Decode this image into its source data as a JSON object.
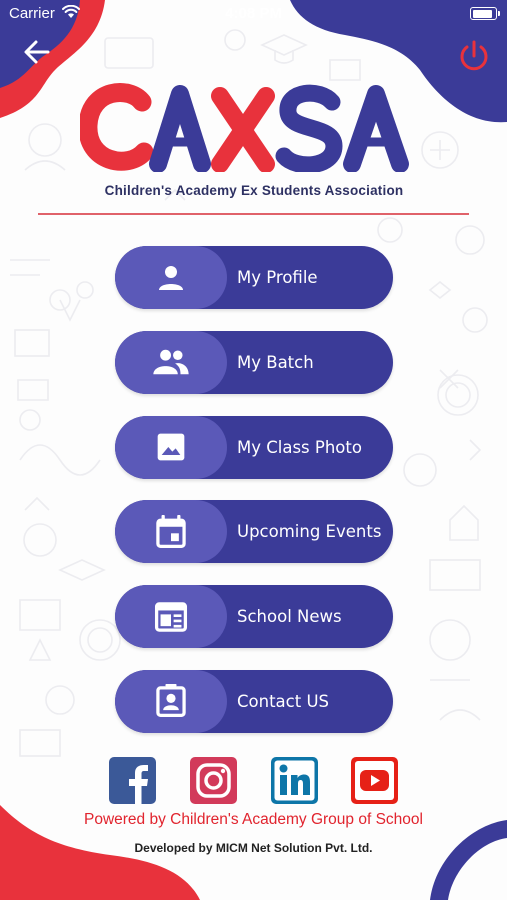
{
  "status_bar": {
    "carrier": "Carrier",
    "time": "4:08 PM"
  },
  "header": {
    "back_icon": "arrow-left-icon",
    "power_icon": "power-icon"
  },
  "brand": {
    "logo_text": "CAXSA",
    "subtitle": "Children's Academy Ex Students Association",
    "colors": {
      "red": "#e8323c",
      "navy": "#3b3b98"
    }
  },
  "menu": {
    "items": [
      {
        "label": "My Profile",
        "icon": "person-icon"
      },
      {
        "label": "My Batch",
        "icon": "group-icon"
      },
      {
        "label": "My Class Photo",
        "icon": "image-icon"
      },
      {
        "label": "Upcoming Events",
        "icon": "calendar-icon"
      },
      {
        "label": "School News",
        "icon": "news-icon"
      },
      {
        "label": "Contact US",
        "icon": "contact-card-icon"
      }
    ],
    "colors": {
      "button": "#3b3b98",
      "icon_panel": "#5b59b8"
    }
  },
  "social": [
    {
      "name": "facebook-icon",
      "color": "#3b5998"
    },
    {
      "name": "instagram-icon",
      "color": "#e1306c"
    },
    {
      "name": "linkedin-icon",
      "color": "#0e76a8"
    },
    {
      "name": "youtube-icon",
      "color": "#e62117"
    }
  ],
  "footer": {
    "powered_by": "Powered by Children's Academy Group of School",
    "developed_by": "Developed by MICM Net Solution Pvt. Ltd."
  }
}
